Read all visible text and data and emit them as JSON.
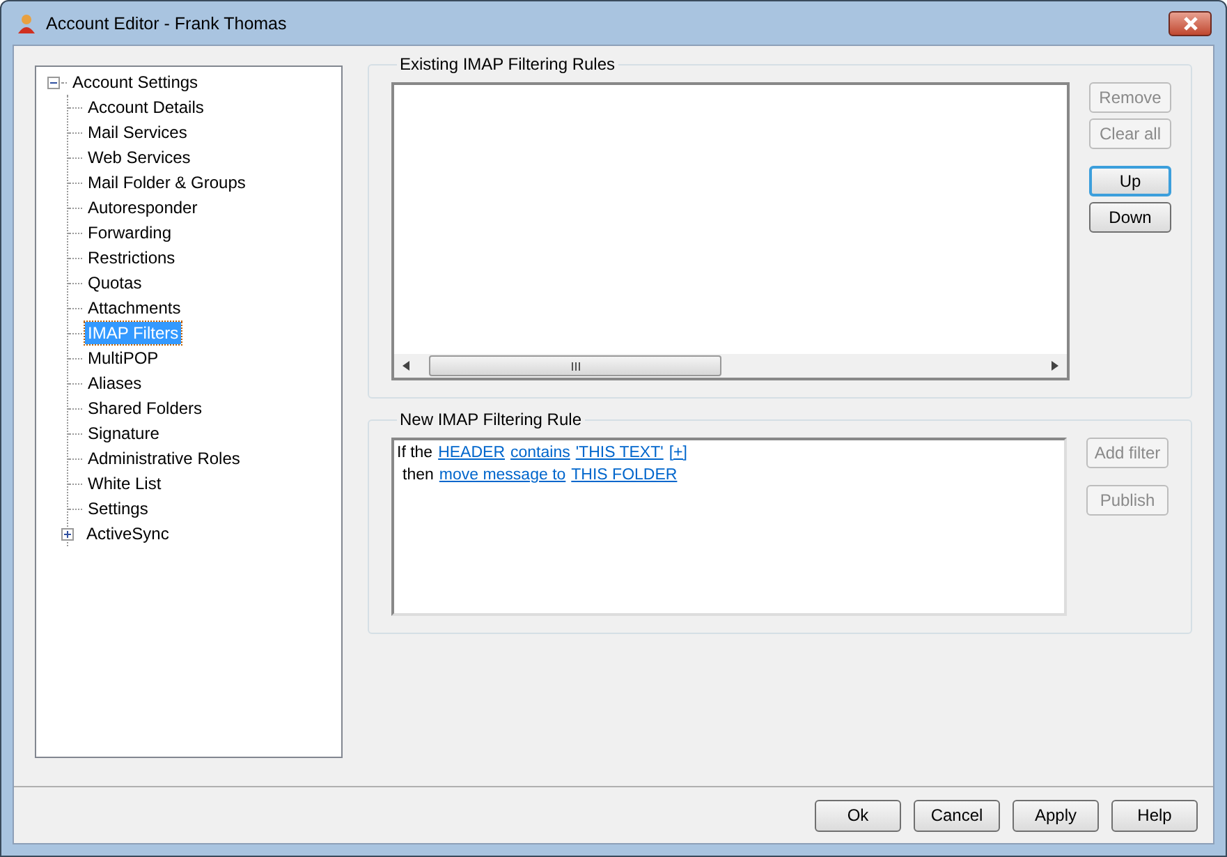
{
  "window": {
    "title": "Account Editor - Frank Thomas"
  },
  "tree": [
    {
      "label": "Account Settings",
      "expanded": true,
      "children": [
        {
          "label": "Account Details",
          "selected": false
        },
        {
          "label": "Mail Services",
          "selected": false
        },
        {
          "label": "Web Services",
          "selected": false
        },
        {
          "label": "Mail Folder & Groups",
          "selected": false
        },
        {
          "label": "Autoresponder",
          "selected": false
        },
        {
          "label": "Forwarding",
          "selected": false
        },
        {
          "label": "Restrictions",
          "selected": false
        },
        {
          "label": "Quotas",
          "selected": false
        },
        {
          "label": "Attachments",
          "selected": false
        },
        {
          "label": "IMAP Filters",
          "selected": true
        },
        {
          "label": "MultiPOP",
          "selected": false
        },
        {
          "label": "Aliases",
          "selected": false
        },
        {
          "label": "Shared Folders",
          "selected": false
        },
        {
          "label": "Signature",
          "selected": false
        },
        {
          "label": "Administrative Roles",
          "selected": false
        },
        {
          "label": "White List",
          "selected": false
        },
        {
          "label": "Settings",
          "selected": false
        },
        {
          "label": "ActiveSync",
          "selected": false,
          "expanded": false
        }
      ]
    }
  ],
  "existing_rules": {
    "title": "Existing IMAP Filtering Rules",
    "buttons": [
      {
        "label": "Remove",
        "disabled": true,
        "focused": false
      },
      {
        "label": "Clear all",
        "disabled": true,
        "focused": false
      },
      {
        "label": "Up",
        "disabled": false,
        "focused": true
      },
      {
        "label": "Down",
        "disabled": false,
        "focused": false
      }
    ]
  },
  "new_rule": {
    "title": "New IMAP Filtering Rule",
    "lines": [
      [
        {
          "kind": "text",
          "text": "If the"
        },
        {
          "kind": "link",
          "text": "HEADER"
        },
        {
          "kind": "link",
          "text": "contains"
        },
        {
          "kind": "link",
          "text": "'THIS TEXT'"
        },
        {
          "kind": "link",
          "text": "[+]"
        }
      ],
      [
        {
          "kind": "text",
          "text": "then"
        },
        {
          "kind": "link",
          "text": "move message to"
        },
        {
          "kind": "link",
          "text": "THIS FOLDER"
        }
      ]
    ],
    "buttons": [
      {
        "label": "Add filter",
        "disabled": true
      },
      {
        "label": "Publish",
        "disabled": true
      }
    ]
  },
  "footer_buttons": [
    {
      "label": "Ok"
    },
    {
      "label": "Cancel"
    },
    {
      "label": "Apply"
    },
    {
      "label": "Help"
    }
  ]
}
